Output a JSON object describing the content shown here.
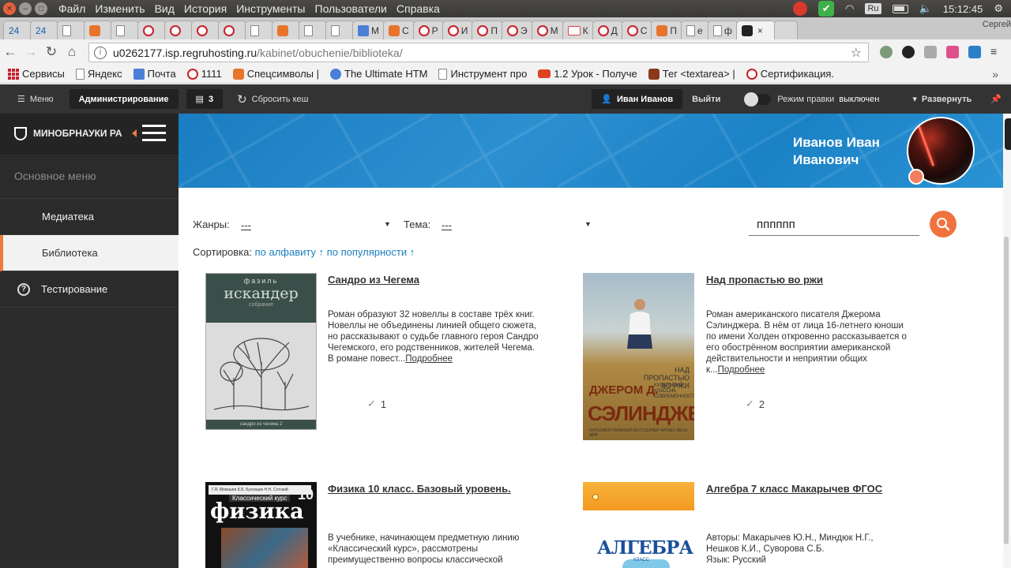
{
  "os": {
    "menu": [
      "Файл",
      "Изменить",
      "Вид",
      "История",
      "Инструменты",
      "Пользователи",
      "Справка"
    ],
    "lang": "Ru",
    "time": "15:12:45"
  },
  "tabs": [
    {
      "label": "24",
      "icon": "number-icon"
    },
    {
      "label": "24",
      "icon": "number-icon"
    },
    {
      "label": "",
      "icon": "doc-icon"
    },
    {
      "label": "",
      "icon": "orange-icon"
    },
    {
      "label": "",
      "icon": "doc-icon"
    },
    {
      "label": "",
      "icon": "red-circle-icon"
    },
    {
      "label": "",
      "icon": "red-circle-icon"
    },
    {
      "label": "",
      "icon": "red-circle-icon"
    },
    {
      "label": "",
      "icon": "red-circle-icon"
    },
    {
      "label": "",
      "icon": "doc-icon"
    },
    {
      "label": "",
      "icon": "orange-icon"
    },
    {
      "label": "",
      "icon": "doc-icon"
    },
    {
      "label": "",
      "icon": "doc-icon"
    },
    {
      "label": "M",
      "icon": "blue-icon"
    },
    {
      "label": "C",
      "icon": "orange-icon"
    },
    {
      "label": "P",
      "icon": "red-circle-icon"
    },
    {
      "label": "И",
      "icon": "red-circle-icon"
    },
    {
      "label": "П",
      "icon": "red-circle-icon"
    },
    {
      "label": "Э",
      "icon": "red-circle-icon"
    },
    {
      "label": "M",
      "icon": "red-circle-icon"
    },
    {
      "label": "К",
      "icon": "vk-icon"
    },
    {
      "label": "Д",
      "icon": "red-circle-icon"
    },
    {
      "label": "С",
      "icon": "red-circle-icon"
    },
    {
      "label": "П",
      "icon": "orange-icon"
    },
    {
      "label": "е",
      "icon": "doc-icon"
    },
    {
      "label": "ф",
      "icon": "doc-icon"
    },
    {
      "label": "",
      "icon": "active-tab-icon",
      "active": true
    }
  ],
  "tab_user": "Сергей",
  "address": {
    "host": "u0262177.isp.regruhosting.ru",
    "path": "/kabinet/obuchenie/biblioteka/"
  },
  "bookmarks": [
    {
      "label": "Сервисы",
      "icon": "apps-icon"
    },
    {
      "label": "Яндекс",
      "icon": "doc-icon"
    },
    {
      "label": "Почта",
      "icon": "mail-icon"
    },
    {
      "label": "1111",
      "icon": "red-circle-icon"
    },
    {
      "label": "Спецсимволы | ",
      "icon": "bookmark-icon"
    },
    {
      "label": "The Ultimate HTM",
      "icon": "blue-icon"
    },
    {
      "label": "Инструмент про",
      "icon": "doc-icon"
    },
    {
      "label": "1.2 Урок - Получе",
      "icon": "youtube-icon"
    },
    {
      "label": "Тег <textarea> | ",
      "icon": "bookmark-icon"
    },
    {
      "label": "Сертификация. ",
      "icon": "red-circle-icon"
    }
  ],
  "admin_bar": {
    "menu": "Меню",
    "admin": "Администрирование",
    "count": "3",
    "clear_cache": "Сбросить кеш",
    "user": "Иван Иванов",
    "logout": "Выйти",
    "edit_mode": "Режим правки",
    "edit_state": "выключен",
    "expand": "Развернуть"
  },
  "sidebar": {
    "brand": "МИНОБРНАУКИ РА",
    "section": "Основное меню",
    "items": [
      {
        "label": "Медиатека"
      },
      {
        "label": "Библиотека",
        "active": true
      },
      {
        "label": "Тестирование"
      }
    ]
  },
  "profile": {
    "name": "Иванов Иван Иванович"
  },
  "filters": {
    "genre_label": "Жанры:",
    "genre_value": "---",
    "theme_label": "Тема:",
    "theme_value": "---",
    "search_value": "пппппп",
    "sort_label": "Сортировка:",
    "sort_alpha": "по алфавиту ↑",
    "sort_pop": "по популярности ↑"
  },
  "books": [
    {
      "title": "Сандро из Чегема",
      "description": "Роман образуют 32 новеллы в составе трёх книг. Новеллы не объединены линией общего сюжета, но рассказывают о судьбе главного героя Сандро Чегемского, его родственников, жителей Чегема. В романе повест...",
      "more": "Подробнее",
      "count": "1",
      "cover": {
        "author_small": "фазиль",
        "author": "искандер",
        "sub": "собрание",
        "bottom": "сандро из чегема 2"
      }
    },
    {
      "title": "Над пропастью во ржи",
      "description": "Роман американского писателя Джерома Сэлинджера. В нём от лица 16-летнего юноши по имени Холден откровенно рассказывается о его обострённом восприятии американской действительности и неприятии общих к...",
      "more": "Подробнее",
      "count": "2",
      "cover": {
        "title": "НАД ПРОПАСТЬЮ ВО РЖИ",
        "author1": "ДЖЕРОМ Д.",
        "series": "КУЛЬТОВЫЙ КЛАССИК СОВРЕМЕННОСТИ",
        "author2": "СЭЛИНДЖЕР",
        "bottom": "ИНТЕЛЛЕКТУАЛЬНЫЙ БЕСТСЕЛЛЕР ЧИТАЕТ ВЕСЬ МИР"
      }
    },
    {
      "title": "Физика 10 класс. Базовый уровень.",
      "description": "В учебнике, начинающем предметную линию «Классический курс», рассмотрены преимущественно вопросы классической",
      "cover": {
        "band": "Г.Я. Мякишев Б.Б. Буховцев Н.Н. Сотский",
        "grade": "10",
        "klass": "Классический курс",
        "title": "физика"
      }
    },
    {
      "title": "Алгебра 7 класс Макарычев ФГОС",
      "description": "Авторы: Макарычев Ю.Н., Миндюк Н.Г., Нешков К.И., Суворова С.Б.\nЯзык: Русский",
      "cover": {
        "title": "АЛГЕБРА",
        "klass": "КЛАСС"
      }
    }
  ],
  "colors": {
    "accent": "#f0733f",
    "banner": "#1b82c6",
    "sidebar": "#2b2b2b",
    "link": "#1a7fbf"
  }
}
